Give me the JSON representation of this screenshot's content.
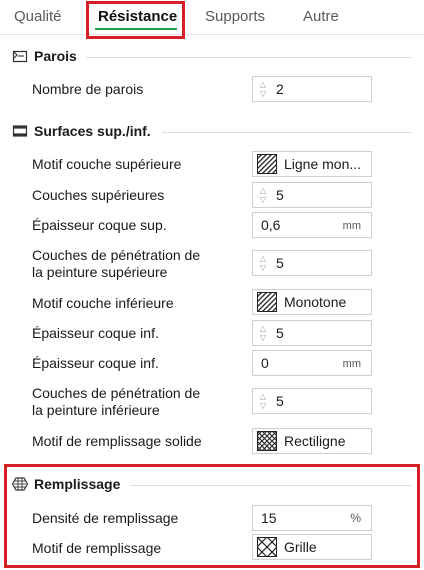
{
  "tabs": [
    {
      "label": "Qualité",
      "active": false
    },
    {
      "label": "Résistance",
      "active": true
    },
    {
      "label": "Supports",
      "active": false
    },
    {
      "label": "Autre",
      "active": false
    }
  ],
  "colors": {
    "accent": "#1aa34a",
    "highlight_box": "#d41f26"
  },
  "sections": {
    "walls": {
      "title": "Parois",
      "icon": "wall-icon",
      "rows": [
        {
          "label": "Nombre de parois",
          "value": "2"
        }
      ]
    },
    "surfaces": {
      "title": "Surfaces sup./inf.",
      "icon": "layers-icon",
      "rows": [
        {
          "label": "Motif couche supérieure",
          "value": "Ligne mon..."
        },
        {
          "label": "Couches supérieures",
          "value": "5"
        },
        {
          "label": "Épaisseur coque sup.",
          "value": "0,6",
          "unit": "mm"
        },
        {
          "label_line1": "Couches de pénétration de",
          "label_line2": "la peinture supérieure",
          "value": "5"
        },
        {
          "label": "Motif couche inférieure",
          "value": "Monotone"
        },
        {
          "label": "Épaisseur coque inf.",
          "value": "5"
        },
        {
          "label": "Épaisseur coque inf.",
          "value": "0",
          "unit": "mm"
        },
        {
          "label_line1": "Couches de pénétration de",
          "label_line2": "la peinture inférieure",
          "value": "5"
        },
        {
          "label": "Motif de remplissage solide",
          "value": "Rectiligne"
        }
      ]
    },
    "infill": {
      "title": "Remplissage",
      "icon": "infill-icon",
      "rows": [
        {
          "label": "Densité de remplissage",
          "value": "15",
          "unit": "%"
        },
        {
          "label": "Motif de remplissage",
          "value": "Grille"
        }
      ]
    }
  }
}
